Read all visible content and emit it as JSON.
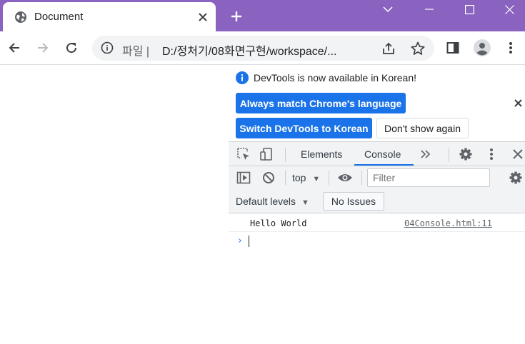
{
  "browser": {
    "tab_title": "Document",
    "address_scheme_label": "파일 |",
    "address_url": "D:/정처기/08화면구현/workspace/..."
  },
  "infobar": {
    "message": "DevTools is now available in Korean!",
    "btn_match_language": "Always match Chrome's language",
    "btn_switch_korean": "Switch DevTools to Korean",
    "btn_dont_show": "Don't show again"
  },
  "devtools": {
    "tabs": [
      "Elements",
      "Console"
    ],
    "active_tab": "Console",
    "context_select": "top",
    "filter_placeholder": "Filter",
    "default_levels": "Default levels",
    "issues_button": "No Issues"
  },
  "console": {
    "messages": [
      {
        "text": "Hello World",
        "source": "04Console.html:11"
      }
    ],
    "prompt": "›"
  },
  "colors": {
    "titlebar": "#8a63c0",
    "accent_blue": "#1a73e8",
    "devtools_toolbar": "#f1f3f4"
  }
}
